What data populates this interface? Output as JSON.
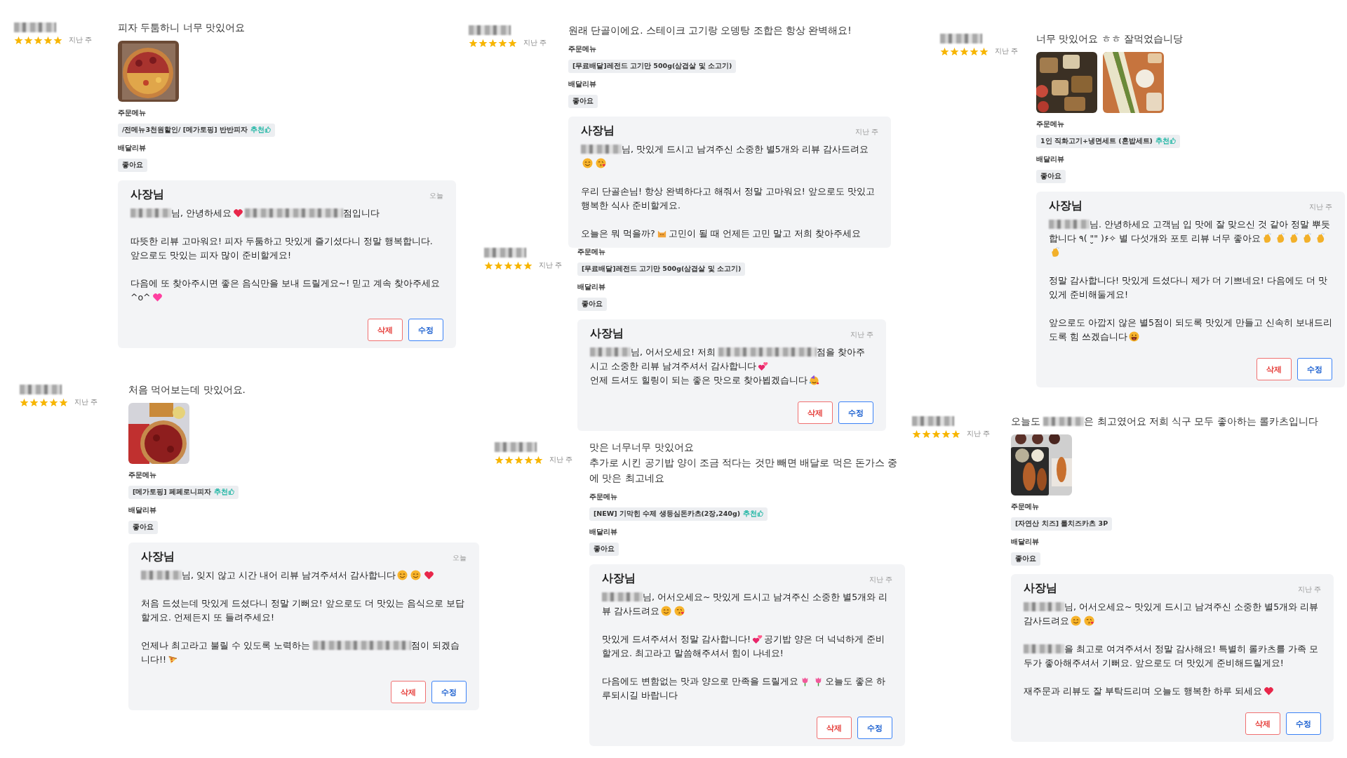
{
  "reviews": [
    {
      "stars": 5,
      "time": "지난 주",
      "review": [
        [
          "피자 두툼하니 너무 맛있어요"
        ]
      ],
      "photos": [
        {
          "kind": "picture"
        }
      ],
      "menu_label": "주문메뉴",
      "menu": {
        "text": "/전메뉴3천원할인/ [메가토핑] 반반피자",
        "recommend": "추천"
      },
      "delivery_label": "배달리뷰",
      "delivery": "좋아요",
      "reply": {
        "author": "사장님",
        "time": "오늘",
        "paragraphs": [
          [
            [
              {
                "kind": "blur"
              },
              "님, 안녕하세요",
              {
                "kind": "heart"
              },
              {
                "kind": "blur-long"
              },
              "점입니다"
            ]
          ],
          [
            [
              "따뜻한 리뷰 고마워요! 피자 두툼하고 맛있게 즐기셨다니 정말 행복합니다. 앞으로도 맛있는 피자 많이 준비할게요!"
            ]
          ],
          [
            [
              "다음에 또 찾아주시면 좋은 음식만을 보내 드릴게요~! 믿고 계속 찾아주세요^o^",
              {
                "kind": "pink-heart"
              }
            ]
          ]
        ],
        "buttons": [
          {
            "label": "삭제",
            "kind": "delete"
          },
          {
            "label": "수정",
            "kind": "edit"
          }
        ]
      }
    },
    {
      "stars": 5,
      "time": "지난 주",
      "review": [
        [
          "처음 먹어보는데 맛있어요."
        ]
      ],
      "photos": [
        {
          "kind": "picture"
        }
      ],
      "menu_label": "주문메뉴",
      "menu": {
        "text": "[메가토핑] 페페로니피자",
        "recommend": "추천"
      },
      "delivery_label": "배달리뷰",
      "delivery": "좋아요",
      "reply": {
        "author": "사장님",
        "time": "오늘",
        "paragraphs": [
          [
            [
              {
                "kind": "blur"
              },
              "님, 잊지 않고 시간 내어 리뷰 남겨주셔서 감사합니다",
              {
                "kind": "smile"
              },
              {
                "kind": "smile"
              },
              {
                "kind": "heart"
              }
            ]
          ],
          [
            [
              "처음 드셨는데 맛있게 드셨다니 정말 기뻐요! 앞으로도 더 맛있는 음식으로 보답할게요. 언제든지 또 들려주세요!"
            ]
          ],
          [
            [
              "언제나 최고라고 불릴 수 있도록 노력하는 ",
              {
                "kind": "blur-long"
              },
              "점이 되겠습니다!!",
              {
                "kind": "pizza"
              }
            ]
          ]
        ],
        "buttons": [
          {
            "label": "삭제",
            "kind": "delete"
          },
          {
            "label": "수정",
            "kind": "edit"
          }
        ]
      }
    },
    {
      "stars": 5,
      "time": "지난 주",
      "review": [
        [
          "원래 단골이에요. 스테이크 고기랑 오뎅탕 조합은 항상 완벽해요!"
        ]
      ],
      "menu_label": "주문메뉴",
      "menu": {
        "text": "[무료배달]레전드 고기만 500g(삼겹살 및 소고기)"
      },
      "delivery_label": "배달리뷰",
      "delivery": "좋아요",
      "reply": {
        "author": "사장님",
        "time": "지난 주",
        "paragraphs": [
          [
            [
              {
                "kind": "blur"
              },
              "님, 맛있게 드시고 남겨주신 소중한 별5개와 리뷰 감사드려요",
              {
                "kind": "smile"
              },
              {
                "kind": "kiss"
              }
            ]
          ],
          [
            [
              "우리 단골손님! 항상 완벽하다고 해줘서 정말 고마워요! 앞으로도 맛있고 행복한 식사 준비할게요."
            ]
          ],
          [
            [
              "오늘은 뭐 먹을까?",
              {
                "kind": "cat"
              },
              "고민이 될 때 언제든 고민 말고 저희 찾아주세요"
            ]
          ]
        ]
      }
    },
    {
      "stars": 5,
      "time": "지난 주",
      "menu_label": "주문메뉴",
      "menu": {
        "text": "[무료배달]레전드 고기만 500g(삼겹살 및 소고기)"
      },
      "delivery_label": "배달리뷰",
      "delivery": "좋아요",
      "reply": {
        "author": "사장님",
        "time": "지난 주",
        "paragraphs": [
          [
            [
              {
                "kind": "blur"
              },
              "님, 어서오세요! 저희 ",
              {
                "kind": "blur-long"
              },
              "점을 찾아주시고 소중한 리뷰 남겨주셔서 감사합니다",
              {
                "kind": "hearts"
              }
            ],
            [
              "언제 드셔도 힐링이 되는 좋은 맛으로 찾아뵙겠습니다",
              {
                "kind": "party"
              }
            ]
          ]
        ],
        "buttons": [
          {
            "label": "삭제",
            "kind": "delete"
          },
          {
            "label": "수정",
            "kind": "edit"
          }
        ]
      }
    },
    {
      "stars": 5,
      "time": "지난 주",
      "review": [
        [
          "맛은 너무너무 맛있어요"
        ],
        [
          "추가로 시킨 공기밥 양이 조금 적다는 것만 빼면 배달로 먹은 돈가스 중에 맛은 최고네요"
        ]
      ],
      "menu_label": "주문메뉴",
      "menu": {
        "text": "[NEW] 기막힌 수제 생등심돈카츠(2장,240g)",
        "recommend": "추천"
      },
      "delivery_label": "배달리뷰",
      "delivery": "좋아요",
      "reply": {
        "author": "사장님",
        "time": "지난 주",
        "paragraphs": [
          [
            [
              {
                "kind": "blur"
              },
              "님, 어서오세요~ 맛있게 드시고 남겨주신 소중한 별5개와 리뷰 감사드려요",
              {
                "kind": "smile"
              },
              {
                "kind": "kiss"
              }
            ]
          ],
          [
            [
              "맛있게 드셔주셔서 정말 감사합니다!",
              {
                "kind": "hearts"
              },
              "공기밥 양은 더 넉넉하게 준비할게요. 최고라고 말씀해주셔서 힘이 나네요!"
            ]
          ],
          [
            [
              "다음에도 변함없는 맛과 양으로 만족을 드릴게요",
              {
                "kind": "tulip"
              },
              {
                "kind": "tulip"
              },
              "오늘도 좋은 하루되시길 바랍니다"
            ]
          ]
        ],
        "buttons": [
          {
            "label": "삭제",
            "kind": "delete"
          },
          {
            "label": "수정",
            "kind": "edit"
          }
        ]
      }
    },
    {
      "stars": 5,
      "time": "지난 주",
      "review": [
        [
          "너무 맛있어요 ㅎㅎ 잘먹었습니당"
        ]
      ],
      "photos": [
        {
          "kind": "picture"
        },
        {
          "kind": "picture"
        }
      ],
      "menu_label": "주문메뉴",
      "menu": {
        "text": "1인 직화고기+냉면세트 (혼밥세트)",
        "recommend": "추천"
      },
      "delivery_label": "배달리뷰",
      "delivery": "좋아요",
      "reply": {
        "author": "사장님",
        "time": "지난 주",
        "paragraphs": [
          [
            [
              {
                "kind": "blur"
              },
              "님. 안녕하세요 고객님 입 맛에 잘 맞으신 것 같아 정말 뿌듯합니다 ٩( \"̮\" )۶✧ 별 다섯개와 포토 리뷰 너무 좋아요",
              {
                "kind": "clap"
              },
              {
                "kind": "clap"
              },
              {
                "kind": "clap"
              },
              {
                "kind": "clap"
              },
              {
                "kind": "clap"
              },
              {
                "kind": "clap"
              }
            ]
          ],
          [
            [
              "정말 감사합니다! 맛있게 드셨다니 제가 더 기쁘네요! 다음에도 더 맛있게 준비해둘게요!"
            ]
          ],
          [
            [
              "앞으로도 아깝지 않은 별5점이 되도록 맛있게 만들고 신속히 보내드리도록 힘 쓰겠습니다",
              {
                "kind": "grin"
              }
            ]
          ]
        ],
        "buttons": [
          {
            "label": "삭제",
            "kind": "delete"
          },
          {
            "label": "수정",
            "kind": "edit"
          }
        ]
      }
    },
    {
      "stars": 5,
      "time": "지난 주",
      "review": [
        [
          "오늘도 ",
          {
            "kind": "blur"
          },
          "은 최고였어요 저희 식구 모두 좋아하는 롤카츠입니다"
        ]
      ],
      "photos": [
        {
          "kind": "picture"
        }
      ],
      "menu_label": "주문메뉴",
      "menu": {
        "text": "[자연산 치즈] 롤치즈카츠 3P"
      },
      "delivery_label": "배달리뷰",
      "delivery": "좋아요",
      "reply": {
        "author": "사장님",
        "time": "지난 주",
        "paragraphs": [
          [
            [
              {
                "kind": "blur"
              },
              "님, 어서오세요~ 맛있게 드시고 남겨주신 소중한 별5개와 리뷰 감사드려요",
              {
                "kind": "smile"
              },
              {
                "kind": "kiss"
              }
            ]
          ],
          [
            [
              {
                "kind": "blur"
              },
              "을 최고로 여겨주셔서 정말 감사해요! 특별히 롤카츠를 가족 모두가 좋아해주셔서 기뻐요. 앞으로도 더 맛있게 준비해드릴게요!"
            ]
          ],
          [
            [
              "재주문과 리뷰도 잘 부탁드리며 오늘도 행복한 하루 되세요",
              {
                "kind": "heart"
              }
            ]
          ]
        ],
        "buttons": [
          {
            "label": "삭제",
            "kind": "delete"
          },
          {
            "label": "수정",
            "kind": "edit"
          }
        ]
      }
    }
  ]
}
